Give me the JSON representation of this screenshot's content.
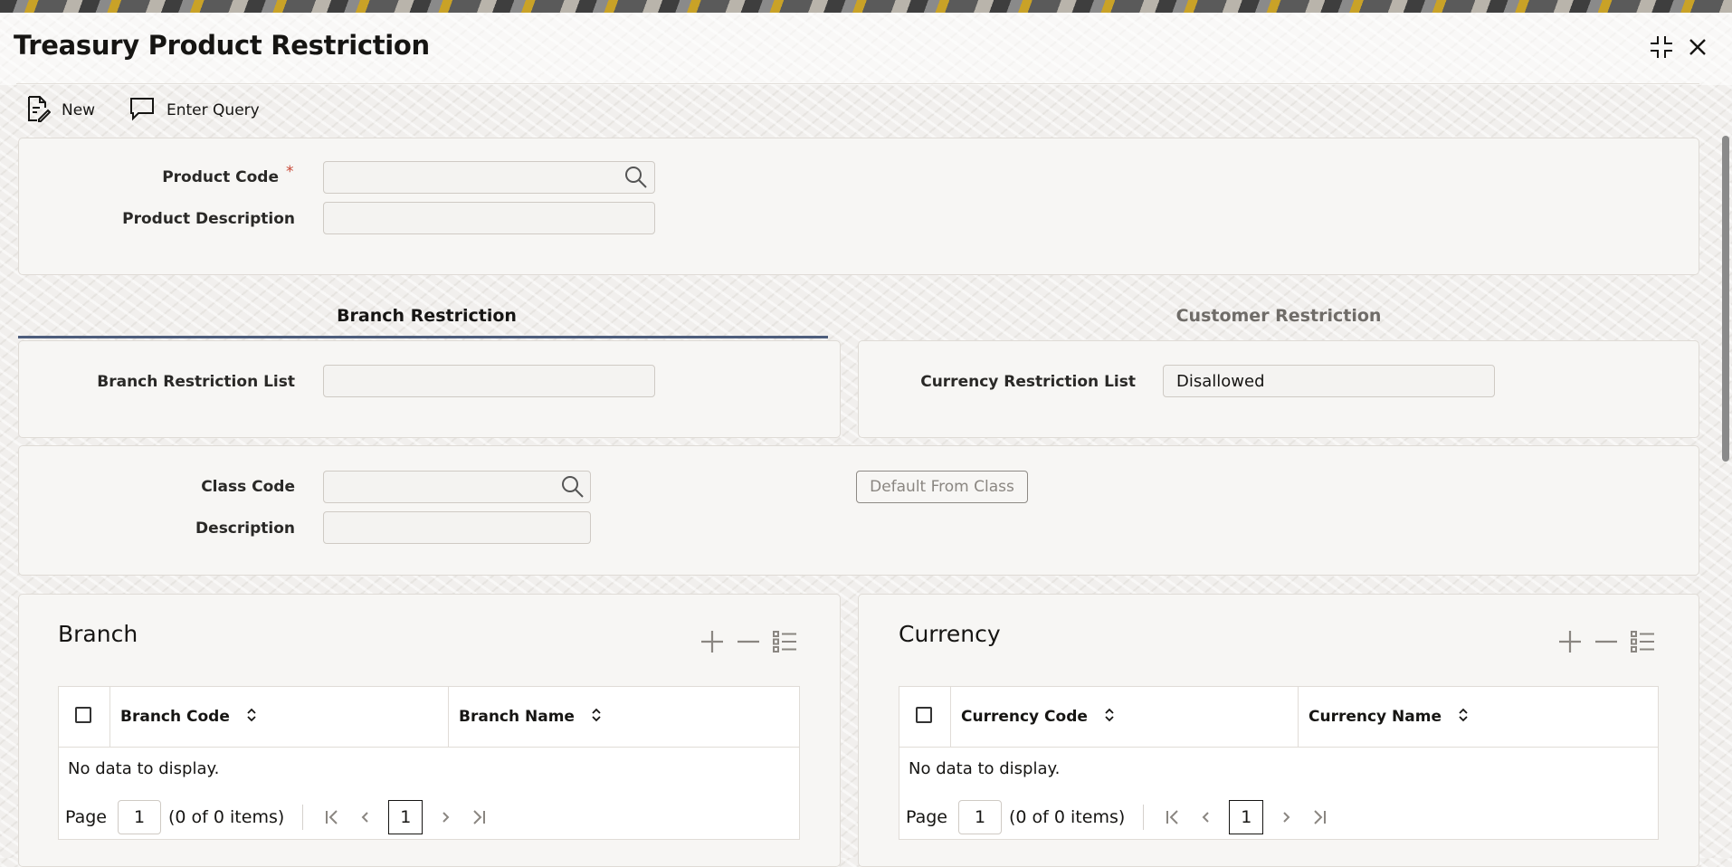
{
  "window": {
    "title": "Treasury Product Restriction",
    "maximize_icon": "compress-arrows-icon",
    "close_icon": "close-icon"
  },
  "toolbar": {
    "new_label": "New",
    "enter_query_label": "Enter Query"
  },
  "product": {
    "code_label": "Product Code",
    "required_mark": "*",
    "code_value": "",
    "description_label": "Product Description",
    "description_value": ""
  },
  "tabs": [
    {
      "label": "Branch Restriction",
      "active": true
    },
    {
      "label": "Customer Restriction",
      "active": false
    }
  ],
  "restriction": {
    "branch_list_label": "Branch Restriction List",
    "branch_list_value": "",
    "currency_list_label": "Currency Restriction List",
    "currency_list_value": "Disallowed"
  },
  "class": {
    "code_label": "Class Code",
    "code_value": "",
    "description_label": "Description",
    "description_value": "",
    "default_button": "Default From Class"
  },
  "branch_grid": {
    "title": "Branch",
    "columns": [
      "Branch Code",
      "Branch Name"
    ],
    "rows": [],
    "empty_text": "No data to display.",
    "pager": {
      "page_label": "Page",
      "page_value": "1",
      "summary": "(0 of 0 items)",
      "current_page": "1"
    }
  },
  "currency_grid": {
    "title": "Currency",
    "columns": [
      "Currency Code",
      "Currency Name"
    ],
    "rows": [],
    "empty_text": "No data to display.",
    "pager": {
      "page_label": "Page",
      "page_value": "1",
      "summary": "(0 of 0 items)",
      "current_page": "1"
    }
  },
  "colors": {
    "accent_tab": "#4d5d7c",
    "required": "#c74634",
    "panel_bg": "#f7f6f4"
  }
}
